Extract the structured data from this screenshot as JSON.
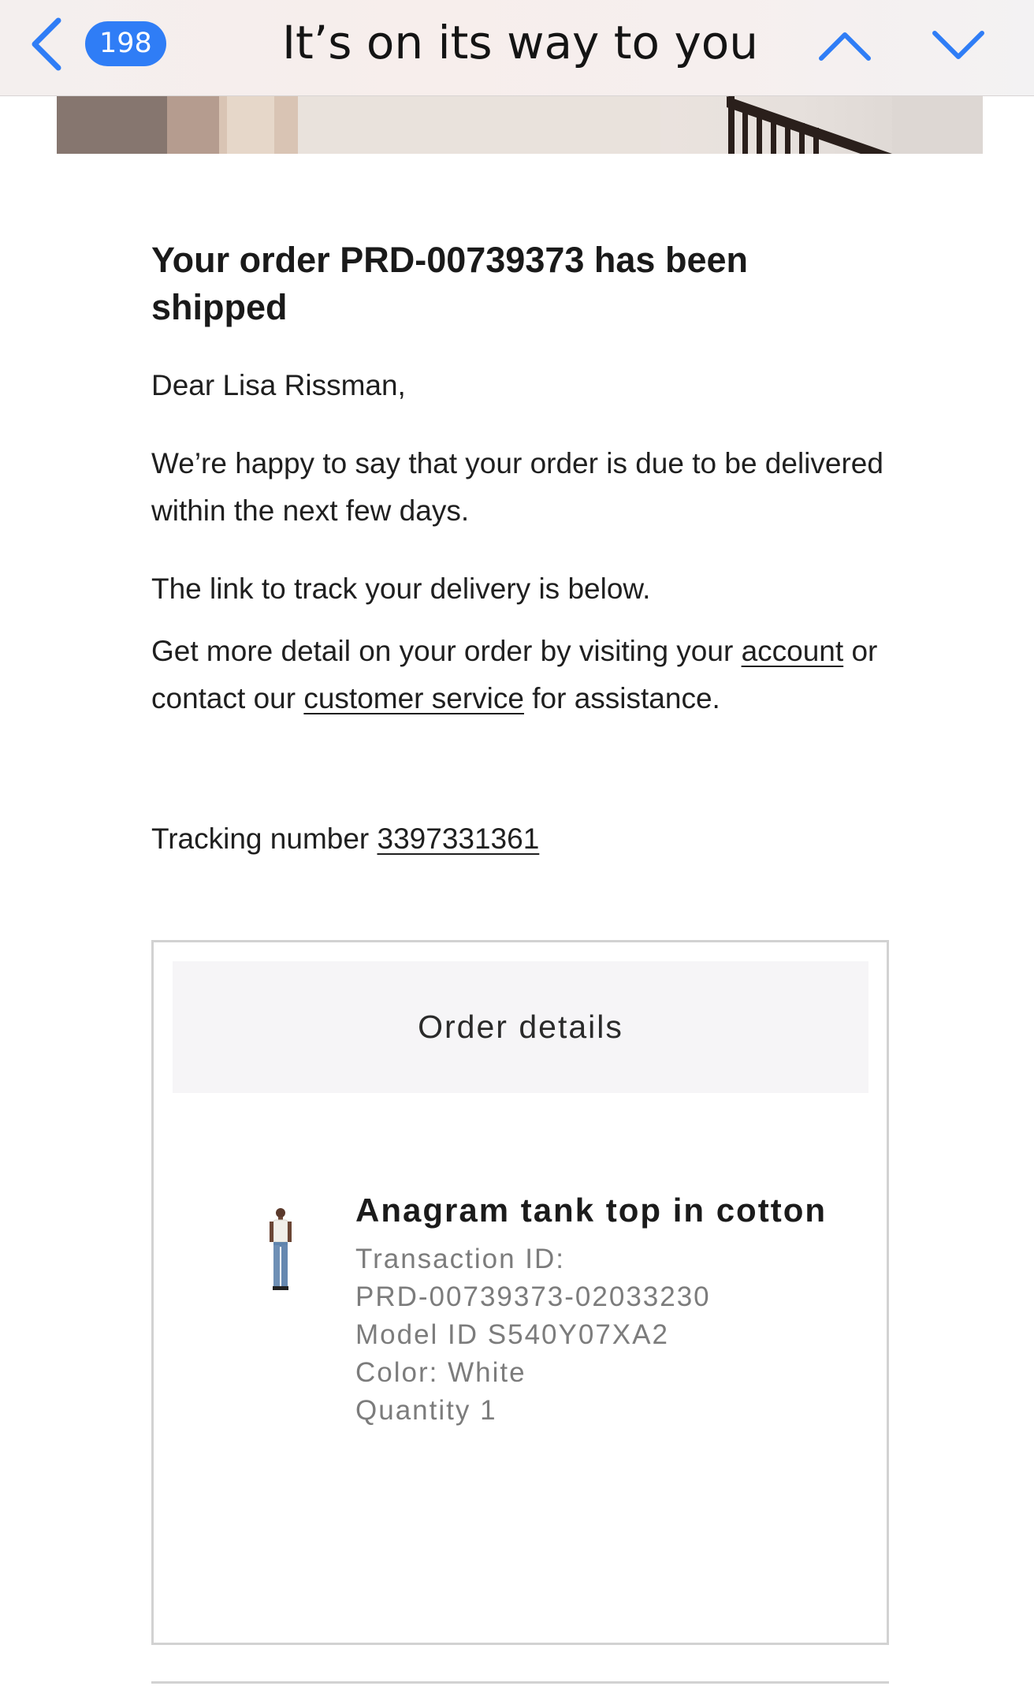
{
  "nav": {
    "unread_count": "198",
    "subject": "It’s on its way to you"
  },
  "email": {
    "heading": "Your order PRD-00739373 has been shipped",
    "greeting": "Dear Lisa Rissman,",
    "para1": "We’re happy to say that your order is due to be delivered within the next few days.",
    "para2": "The link to track your delivery is below.",
    "para3_before": "Get more detail on your order by visiting your ",
    "para3_link_account": "account",
    "para3_middle": " or contact our ",
    "para3_link_service": "customer service",
    "para3_after": " for assistance.",
    "tracking_label": "Tracking number ",
    "tracking_number": "3397331361"
  },
  "order": {
    "header": "Order details",
    "item": {
      "name": "Anagram tank top in cotton",
      "transaction_label": "Transaction ID:",
      "transaction_id": "PRD-00739373-02033230",
      "model": "Model ID S540Y07XA2",
      "color": "Color: White",
      "quantity": "Quantity 1"
    }
  },
  "colors": {
    "accent": "#2f7df6",
    "muted_text": "#7c7c7c",
    "box_border": "#d2d2d2"
  }
}
